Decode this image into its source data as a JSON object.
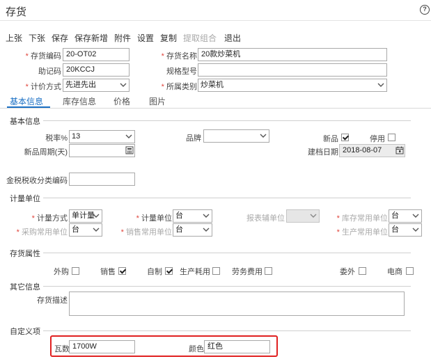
{
  "window": {
    "title": "存货"
  },
  "toolbar": {
    "items": [
      {
        "label": "上张"
      },
      {
        "label": "下张"
      },
      {
        "label": "保存"
      },
      {
        "label": "保存新增"
      },
      {
        "label": "附件"
      },
      {
        "label": "设置"
      },
      {
        "label": "复制"
      },
      {
        "label": "提取组合",
        "disabled": true
      },
      {
        "label": "退出"
      }
    ]
  },
  "header": {
    "code_label": "存货编码",
    "code_value": "20-OT02",
    "name_label": "存货名称",
    "name_value": "20款炒菜机",
    "mnemonic_label": "助记码",
    "mnemonic_value": "20KCCJ",
    "spec_label": "规格型号",
    "spec_value": "",
    "costing_label": "计价方式",
    "costing_value": "先进先出",
    "category_label": "所属类别",
    "category_value": "炒菜机"
  },
  "tabs": [
    {
      "label": "基本信息"
    },
    {
      "label": "库存信息"
    },
    {
      "label": "价格"
    },
    {
      "label": "图片"
    }
  ],
  "basic": {
    "section_title": "基本信息",
    "tax_label": "税率%",
    "tax_value": "13",
    "brand_label": "品牌",
    "brand_value": "",
    "new_label": "新品",
    "new_checked": true,
    "disabled_label": "停用",
    "disabled_checked": false,
    "new_period_label": "新品周期(天)",
    "new_period_value": "",
    "created_label": "建档日期",
    "created_value": "2018-08-07",
    "tax_code_label": "金税税收分类编码",
    "tax_code_value": ""
  },
  "units": {
    "section_title": "计量单位",
    "method_label": "计量方式",
    "method_value": "单计量",
    "unit_label": "计量单位",
    "unit_value": "台",
    "report_label": "报表辅单位",
    "report_value": "",
    "stock_label": "库存常用单位",
    "stock_value": "台",
    "purchase_label": "采购常用单位",
    "purchase_value": "台",
    "sales_label": "销售常用单位",
    "sales_value": "台",
    "production_label": "生产常用单位",
    "production_value": "台"
  },
  "attributes": {
    "section_title": "存货属性",
    "items": [
      {
        "label": "外购",
        "checked": false
      },
      {
        "label": "销售",
        "checked": true
      },
      {
        "label": "自制",
        "checked": true
      },
      {
        "label": "生产耗用",
        "checked": false
      },
      {
        "label": "劳务费用",
        "checked": false
      },
      {
        "label": "委外",
        "checked": false
      },
      {
        "label": "电商",
        "checked": false
      }
    ]
  },
  "other": {
    "section_title": "其它信息",
    "desc_label": "存货描述",
    "desc_value": ""
  },
  "custom": {
    "section_title": "自定义项",
    "power_label": "瓦数",
    "power_value": "1700W",
    "color_label": "颜色",
    "color_value": "红色"
  },
  "colors": {
    "accent": "#1a6fc4",
    "required": "#e0433a",
    "highlight": "#e02020"
  }
}
